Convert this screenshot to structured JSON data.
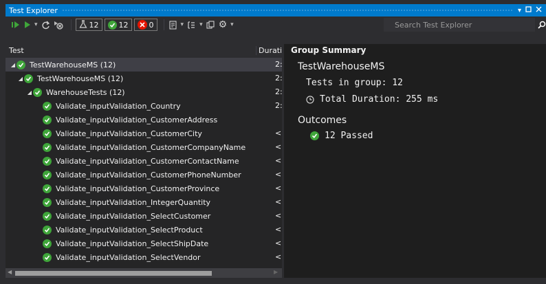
{
  "window": {
    "title": "Test Explorer"
  },
  "toolbar": {
    "run_all_icon": "run-all-icon",
    "run_icon": "run-icon",
    "total_count": "12",
    "passed_count": "12",
    "failed_count": "0",
    "search_placeholder": "Search Test Explorer"
  },
  "columns": {
    "test": "Test",
    "duration": "Duratic"
  },
  "tree": [
    {
      "label": "TestWarehouseMS (12)",
      "indent": 0,
      "expandable": true,
      "duration": "2:",
      "selected": true
    },
    {
      "label": "TestWarehouseMS (12)",
      "indent": 1,
      "expandable": true,
      "duration": "2:",
      "selected": false
    },
    {
      "label": "WarehouseTests (12)",
      "indent": 2,
      "expandable": true,
      "duration": "2:",
      "selected": false
    },
    {
      "label": "Validate_inputValidation_Country",
      "indent": 3,
      "expandable": false,
      "duration": "2:",
      "selected": false
    },
    {
      "label": "Validate_inputValidation_CustomerAddress",
      "indent": 3,
      "expandable": false,
      "duration": "",
      "selected": false
    },
    {
      "label": "Validate_inputValidation_CustomerCity",
      "indent": 3,
      "expandable": false,
      "duration": "<",
      "selected": false
    },
    {
      "label": "Validate_inputValidation_CustomerCompanyName",
      "indent": 3,
      "expandable": false,
      "duration": "<",
      "selected": false
    },
    {
      "label": "Validate_inputValidation_CustomerContactName",
      "indent": 3,
      "expandable": false,
      "duration": "<",
      "selected": false
    },
    {
      "label": "Validate_inputValidation_CustomerPhoneNumber",
      "indent": 3,
      "expandable": false,
      "duration": "<",
      "selected": false
    },
    {
      "label": "Validate_inputValidation_CustomerProvince",
      "indent": 3,
      "expandable": false,
      "duration": "<",
      "selected": false
    },
    {
      "label": "Validate_inputValidation_IntegerQuantity",
      "indent": 3,
      "expandable": false,
      "duration": "<",
      "selected": false
    },
    {
      "label": "Validate_inputValidation_SelectCustomer",
      "indent": 3,
      "expandable": false,
      "duration": "<",
      "selected": false
    },
    {
      "label": "Validate_inputValidation_SelectProduct",
      "indent": 3,
      "expandable": false,
      "duration": "<",
      "selected": false
    },
    {
      "label": "Validate_inputValidation_SelectShipDate",
      "indent": 3,
      "expandable": false,
      "duration": "<",
      "selected": false
    },
    {
      "label": "Validate_inputValidation_SelectVendor",
      "indent": 3,
      "expandable": false,
      "duration": "<",
      "selected": false
    }
  ],
  "summary": {
    "heading": "Group Summary",
    "group_name": "TestWarehouseMS",
    "tests_in_group": "Tests in group: 12",
    "total_duration": "Total Duration: 255 ms",
    "outcomes_heading": "Outcomes",
    "passed": "12 Passed"
  },
  "colors": {
    "accent": "#007acc",
    "passed": "#3fa53a",
    "failed": "#e51400"
  }
}
